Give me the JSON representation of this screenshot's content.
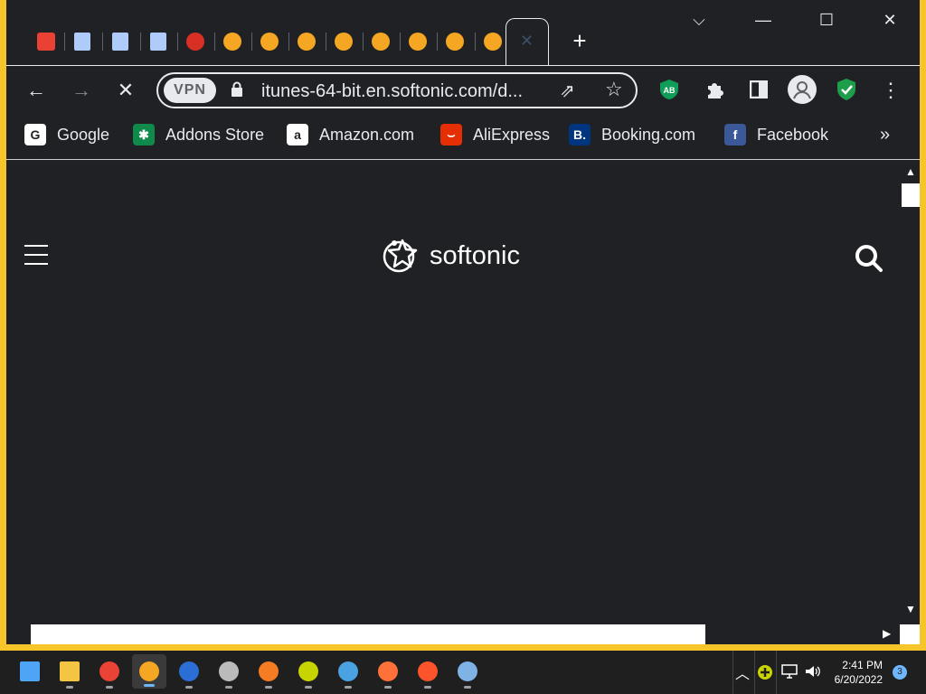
{
  "browser": {
    "tab_close_glyph": "✕",
    "new_tab_glyph": "+",
    "tabs": [
      {
        "icon": "store-icon",
        "color": "#e94235"
      },
      {
        "icon": "document-icon",
        "color": "#aecbfa"
      },
      {
        "icon": "document-icon",
        "color": "#aecbfa"
      },
      {
        "icon": "document-icon",
        "color": "#aecbfa"
      },
      {
        "icon": "shield-icon",
        "color": "#d93025"
      },
      {
        "icon": "browser-logo-icon",
        "color": "#f5a623"
      },
      {
        "icon": "browser-logo-icon",
        "color": "#f5a623"
      },
      {
        "icon": "browser-logo-icon",
        "color": "#f5a623"
      },
      {
        "icon": "browser-logo-icon",
        "color": "#f5a623"
      },
      {
        "icon": "browser-logo-icon",
        "color": "#f5a623"
      },
      {
        "icon": "browser-logo-icon",
        "color": "#f5a623"
      },
      {
        "icon": "browser-logo-icon",
        "color": "#f5a623"
      },
      {
        "icon": "browser-logo-icon",
        "color": "#f5a623"
      }
    ],
    "window_controls": {
      "dropdown": "⌵",
      "minimize": "—",
      "maximize": "☐",
      "close": "✕"
    }
  },
  "toolbar": {
    "back": "←",
    "forward": "→",
    "stop": "✕",
    "vpn_label": "VPN",
    "url": "itunes-64-bit.en.softonic.com/d...",
    "share": "⇗",
    "star": "☆",
    "extension_ab": "AB",
    "menu": "⋮"
  },
  "bookmarks": {
    "items": [
      {
        "label": "Google",
        "icon": "google-icon",
        "color": "#ffffff",
        "glyph": "G"
      },
      {
        "label": "Addons Store",
        "icon": "addons-store-icon",
        "color": "#0f8a4a",
        "glyph": "✱"
      },
      {
        "label": "Amazon.com",
        "icon": "amazon-icon",
        "color": "#ffffff",
        "glyph": "a"
      },
      {
        "label": "AliExpress",
        "icon": "aliexpress-icon",
        "color": "#e62e04",
        "glyph": "⌣"
      },
      {
        "label": "Booking.com",
        "icon": "booking-icon",
        "color": "#003580",
        "glyph": "B."
      },
      {
        "label": "Facebook",
        "icon": "facebook-icon",
        "color": "#3b5998",
        "glyph": "f"
      }
    ],
    "more": "»"
  },
  "page": {
    "logo_text": "softonic"
  },
  "taskbar": {
    "apps": [
      "start-icon",
      "file-explorer-icon",
      "chrome-icon",
      "browser-active-icon",
      "security-shield-icon",
      "scissors-app-icon",
      "vpn-app-icon",
      "plus-app-icon",
      "bird-app-icon",
      "firefox-icon",
      "brave-icon",
      "search-app-icon"
    ],
    "time": "2:41 PM",
    "date": "6/20/2022",
    "notification_count": "3"
  }
}
